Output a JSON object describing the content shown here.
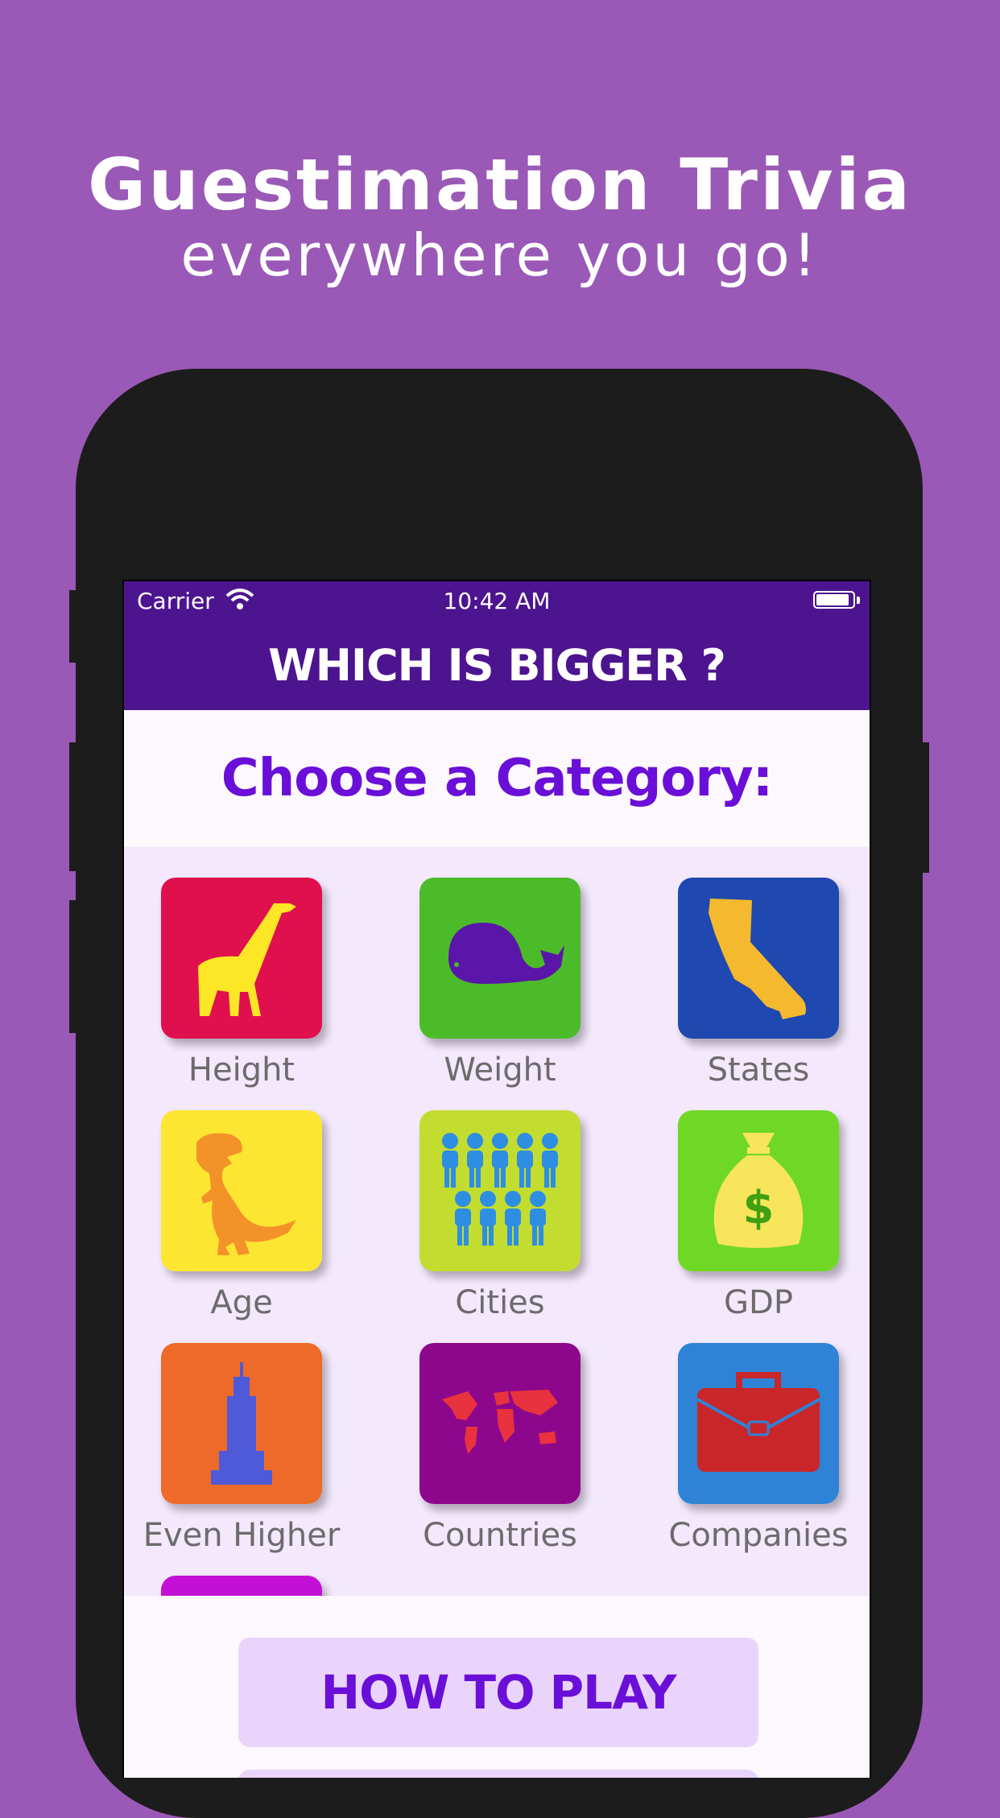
{
  "promo": {
    "title": "Guestimation Trivia",
    "subtitle": "everywhere you go!"
  },
  "status_bar": {
    "carrier": "Carrier",
    "time": "10:42 AM"
  },
  "nav": {
    "title": "WHICH IS BIGGER ?"
  },
  "main": {
    "heading": "Choose a Category:",
    "categories": [
      {
        "label": "Height",
        "icon": "giraffe-icon",
        "color": "#e0104e"
      },
      {
        "label": "Weight",
        "icon": "whale-icon",
        "color": "#4cbb2a"
      },
      {
        "label": "States",
        "icon": "california-icon",
        "color": "#1f48b0"
      },
      {
        "label": "Age",
        "icon": "dinosaur-icon",
        "color": "#fde631"
      },
      {
        "label": "Cities",
        "icon": "people-icon",
        "color": "#c2dc30"
      },
      {
        "label": "GDP",
        "icon": "money-bag-icon",
        "color": "#6fd825"
      },
      {
        "label": "Even Higher",
        "icon": "skyscraper-icon",
        "color": "#ee6a29"
      },
      {
        "label": "Countries",
        "icon": "world-map-icon",
        "color": "#8d078c"
      },
      {
        "label": "Companies",
        "icon": "briefcase-icon",
        "color": "#2e83d6"
      }
    ]
  },
  "buttons": {
    "how_to_play": "HOW TO PLAY"
  }
}
